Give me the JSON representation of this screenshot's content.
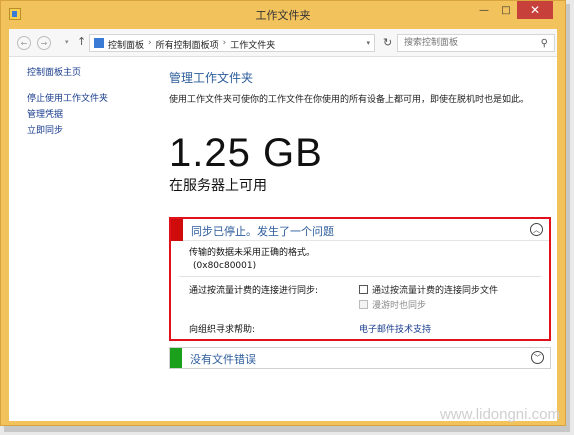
{
  "window": {
    "title": "工作文件夹",
    "controls": {
      "minimize": "—",
      "maximize": "□",
      "close": "✕"
    }
  },
  "toolbar": {
    "back_icon": "←",
    "forward_icon": "→",
    "dropdown_icon": "▾",
    "up_icon": "↑",
    "breadcrumbs": [
      "控制面板",
      "所有控制面板项",
      "工作文件夹"
    ],
    "breadcrumb_sep": "›",
    "refresh_icon": "↻",
    "search_placeholder": "搜索控制面板",
    "search_icon": "⚲"
  },
  "sidebar": {
    "home": "控制面板主页",
    "items": [
      "停止使用工作文件夹",
      "管理凭据",
      "立即同步"
    ]
  },
  "main": {
    "heading": "管理工作文件夹",
    "description": "使用工作文件夹可使你的工作文件在你使用的所有设备上都可用，即使在脱机时也是如此。",
    "size_value": "1.25 GB",
    "size_label": "在服务器上可用"
  },
  "error_panel": {
    "title": "同步已停止。发生了一个问题",
    "collapse_icon": "︿",
    "message": "传输的数据未采用正确的格式。",
    "code": "(0x80c80001)",
    "metered_label": "通过按流量计费的连接进行同步:",
    "metered_option": "通过按流量计费的连接同步文件",
    "roaming_option": "漫游时也同步",
    "help_label": "向组织寻求帮助:",
    "help_link": "电子邮件技术支持"
  },
  "ok_panel": {
    "title": "没有文件错误",
    "expand_icon": "﹀"
  },
  "watermark": "www.lidongni.com",
  "colors": {
    "frame": "#f2c25d",
    "error_accent": "#cf0b0b",
    "error_border": "#e0101c",
    "ok_accent": "#1aa01a",
    "link": "#1a3c8e",
    "heading": "#2d5d9c"
  }
}
